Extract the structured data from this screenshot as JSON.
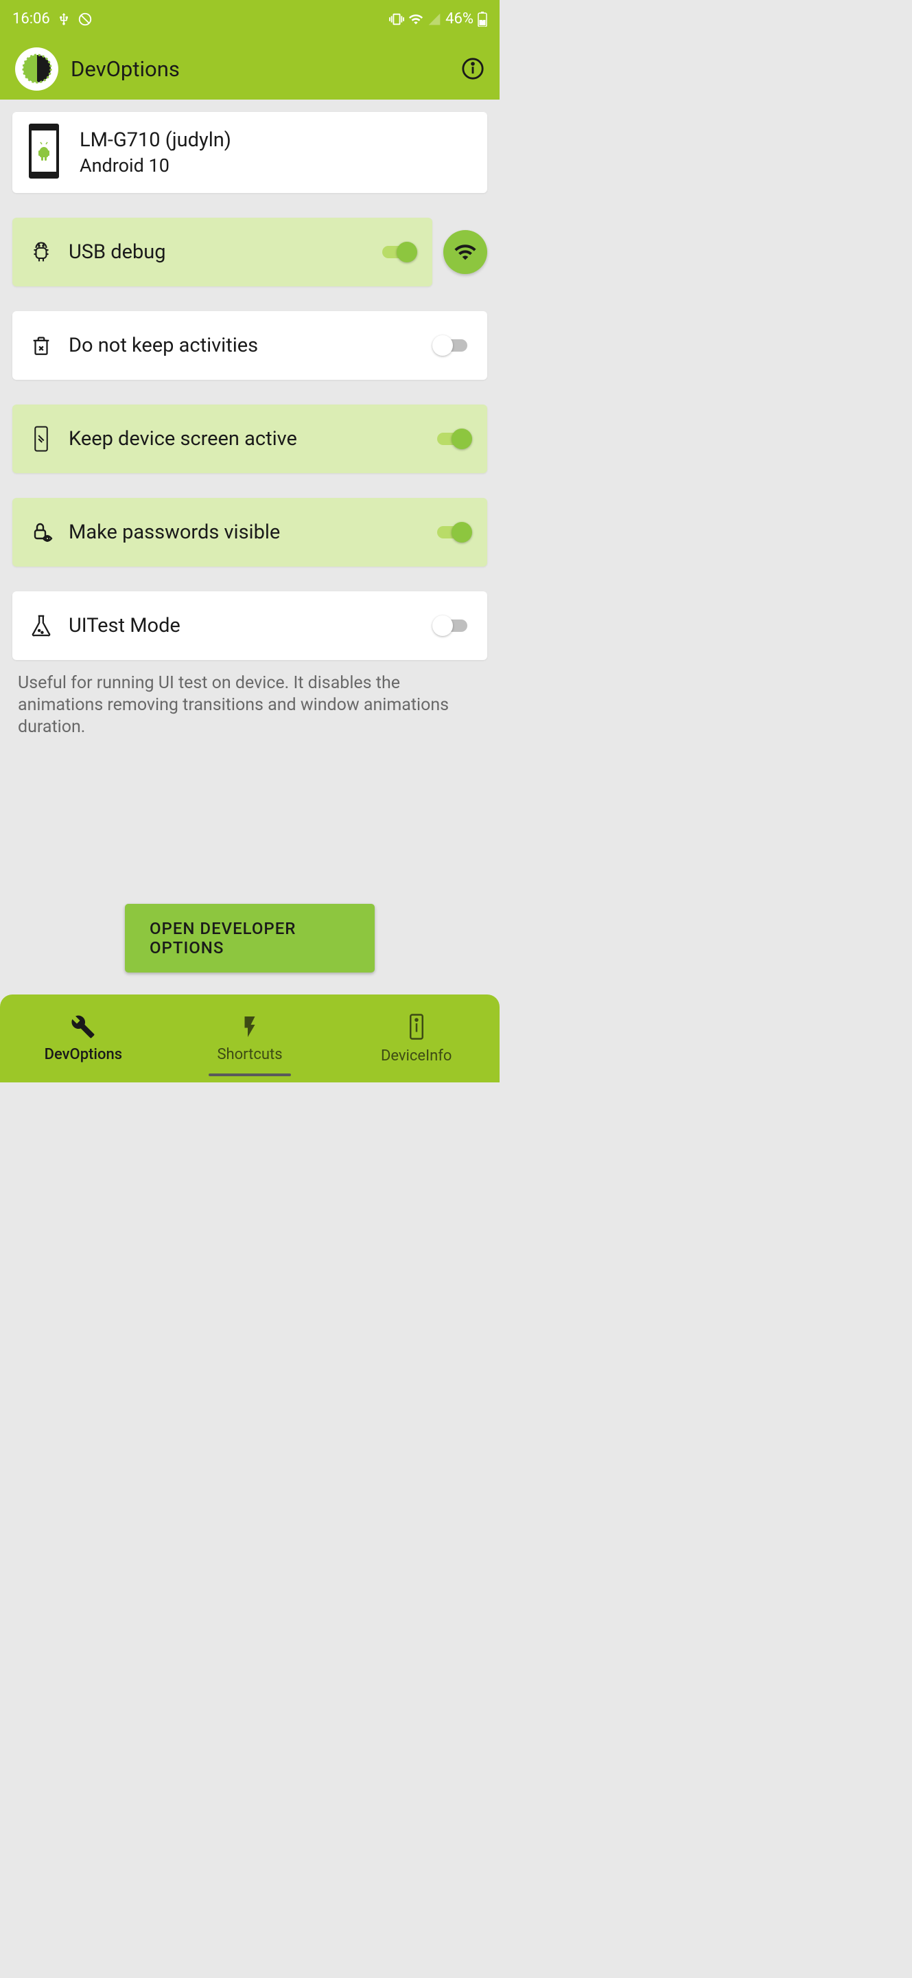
{
  "status_bar": {
    "time": "16:06",
    "battery_percent": "46%"
  },
  "header": {
    "title": "DevOptions"
  },
  "device": {
    "model": "LM-G710 (judyln)",
    "android": "Android 10"
  },
  "settings": {
    "usb_debug": {
      "label": "USB debug",
      "enabled": true
    },
    "no_keep_act": {
      "label": "Do not keep activities",
      "enabled": false
    },
    "keep_screen": {
      "label": "Keep device screen active",
      "enabled": true
    },
    "show_passwords": {
      "label": "Make passwords visible",
      "enabled": true
    },
    "uitest": {
      "label": "UITest Mode",
      "enabled": false
    }
  },
  "uitest_help": "Useful for running UI test on device. It disables the animations removing transitions and window animations duration.",
  "open_dev_options_label": "OPEN DEVELOPER OPTIONS",
  "bottom_nav": {
    "dev_options": "DevOptions",
    "shortcuts": "Shortcuts",
    "device_info": "DeviceInfo"
  }
}
